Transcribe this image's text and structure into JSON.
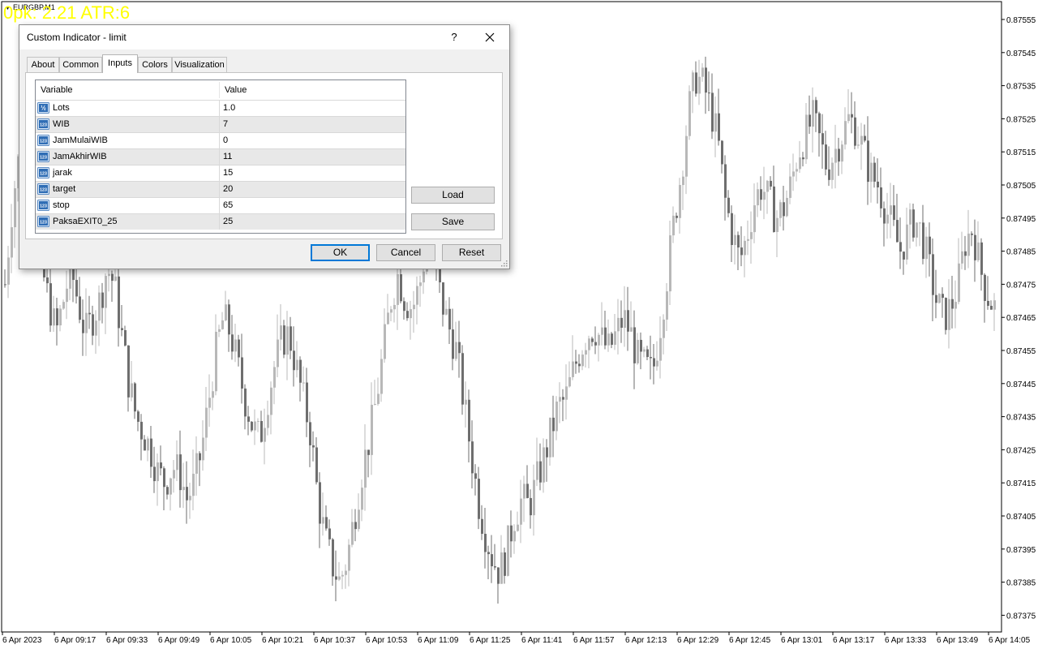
{
  "chart": {
    "symbol": "EURGBP,M1",
    "overlay_text": "0pk: 2.21 ATR:6",
    "colors": {
      "background": "#ffffff",
      "candle_bull": "#b8b8b8",
      "candle_bear": "#6e6e6e",
      "overlay_text": "#ffff00",
      "axis": "#000000"
    },
    "price_axis": [
      "0.87555",
      "0.87545",
      "0.87535",
      "0.87525",
      "0.87515",
      "0.87505",
      "0.87495",
      "0.87485",
      "0.87475",
      "0.87465",
      "0.87455",
      "0.87445",
      "0.87435",
      "0.87425",
      "0.87415",
      "0.87405",
      "0.87395",
      "0.87385",
      "0.87375"
    ],
    "time_axis": [
      "6 Apr 2023",
      "6 Apr 09:17",
      "6 Apr 09:33",
      "6 Apr 09:49",
      "6 Apr 10:05",
      "6 Apr 10:21",
      "6 Apr 10:37",
      "6 Apr 10:53",
      "6 Apr 11:09",
      "6 Apr 11:25",
      "6 Apr 11:41",
      "6 Apr 11:57",
      "6 Apr 12:13",
      "6 Apr 12:29",
      "6 Apr 12:45",
      "6 Apr 13:01",
      "6 Apr 13:17",
      "6 Apr 13:33",
      "6 Apr 13:49",
      "6 Apr 14:05"
    ],
    "close_path": [
      0.87475,
      0.875,
      0.87515,
      0.87505,
      0.8749,
      0.8748,
      0.8747,
      0.8746,
      0.8747,
      0.8748,
      0.8747,
      0.8746,
      0.87465,
      0.8747,
      0.8748,
      0.87475,
      0.8746,
      0.87445,
      0.87435,
      0.8743,
      0.87425,
      0.87418,
      0.87415,
      0.8742,
      0.87418,
      0.8741,
      0.87415,
      0.87425,
      0.8744,
      0.87455,
      0.87465,
      0.8746,
      0.8745,
      0.8744,
      0.87432,
      0.87428,
      0.8744,
      0.8745,
      0.87458,
      0.8746,
      0.8745,
      0.8744,
      0.8743,
      0.8741,
      0.87398,
      0.8739,
      0.87385,
      0.87392,
      0.87405,
      0.87418,
      0.87428,
      0.8744,
      0.87455,
      0.8747,
      0.87478,
      0.8747,
      0.87468,
      0.87475,
      0.87488,
      0.8748,
      0.8747,
      0.87462,
      0.87455,
      0.8744,
      0.87425,
      0.8741,
      0.874,
      0.87392,
      0.87388,
      0.87395,
      0.87405,
      0.8741,
      0.87408,
      0.87415,
      0.87422,
      0.8743,
      0.87438,
      0.8744,
      0.87448,
      0.87455,
      0.8746,
      0.87462,
      0.87458,
      0.87455,
      0.8746,
      0.87465,
      0.8746,
      0.87452,
      0.8745,
      0.87448,
      0.87462,
      0.87478,
      0.87495,
      0.8751,
      0.87528,
      0.87538,
      0.87535,
      0.87528,
      0.87518,
      0.875,
      0.8749,
      0.87482,
      0.8749,
      0.875,
      0.87505,
      0.875,
      0.87495,
      0.87498,
      0.87505,
      0.87515,
      0.8752,
      0.87525,
      0.87518,
      0.8751,
      0.87515,
      0.8752,
      0.87525,
      0.87522,
      0.87515,
      0.87508,
      0.87505,
      0.87498,
      0.87492,
      0.87485,
      0.8749,
      0.87495,
      0.8749,
      0.8748,
      0.8747,
      0.87465,
      0.87468,
      0.87475,
      0.87488,
      0.87492,
      0.8748,
      0.87472,
      0.87468
    ]
  },
  "dialog": {
    "title": "Custom Indicator - limit",
    "help": "?",
    "tabs": [
      {
        "label": "About"
      },
      {
        "label": "Common"
      },
      {
        "label": "Inputs"
      },
      {
        "label": "Colors"
      },
      {
        "label": "Visualization"
      }
    ],
    "active_tab": "Inputs",
    "grid": {
      "header": {
        "variable": "Variable",
        "value": "Value"
      },
      "rows": [
        {
          "type_icon": "double-type-icon",
          "type_glyph": "½",
          "name": "Lots",
          "value": "1.0"
        },
        {
          "type_icon": "int-type-icon",
          "type_glyph": "123",
          "name": "WIB",
          "value": "7"
        },
        {
          "type_icon": "int-type-icon",
          "type_glyph": "123",
          "name": "JamMulaiWIB",
          "value": "0"
        },
        {
          "type_icon": "int-type-icon",
          "type_glyph": "123",
          "name": "JamAkhirWIB",
          "value": "11"
        },
        {
          "type_icon": "int-type-icon",
          "type_glyph": "123",
          "name": "jarak",
          "value": "15"
        },
        {
          "type_icon": "int-type-icon",
          "type_glyph": "123",
          "name": "target",
          "value": "20"
        },
        {
          "type_icon": "int-type-icon",
          "type_glyph": "123",
          "name": "stop",
          "value": "65"
        },
        {
          "type_icon": "int-type-icon",
          "type_glyph": "123",
          "name": "PaksaEXIT0_25",
          "value": "25"
        }
      ]
    },
    "buttons": {
      "load": "Load",
      "save": "Save",
      "ok": "OK",
      "cancel": "Cancel",
      "reset": "Reset"
    }
  }
}
